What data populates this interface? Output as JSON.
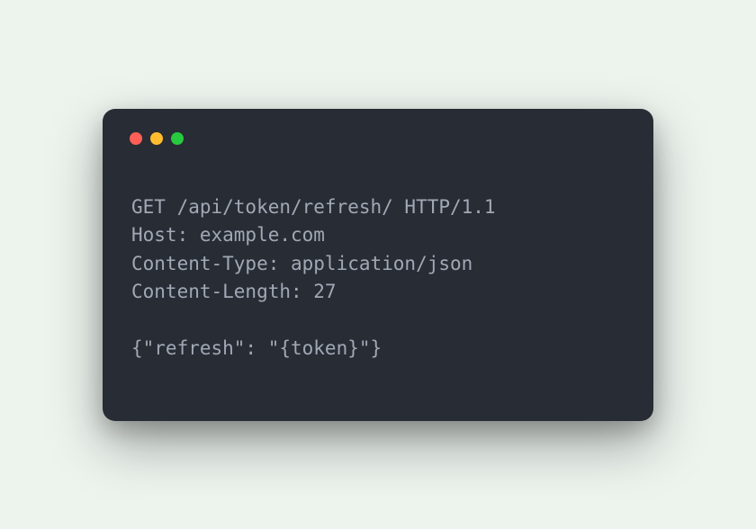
{
  "terminal": {
    "lines": {
      "request_line": "GET /api/token/refresh/ HTTP/1.1",
      "host": "Host: example.com",
      "content_type": "Content-Type: application/json",
      "content_length": "Content-Length: 27",
      "blank": "",
      "body": "{\"refresh\": \"{token}\"}"
    },
    "traffic_lights": {
      "close": "#ff5f56",
      "minimize": "#ffbd2e",
      "zoom": "#27c93f"
    }
  }
}
